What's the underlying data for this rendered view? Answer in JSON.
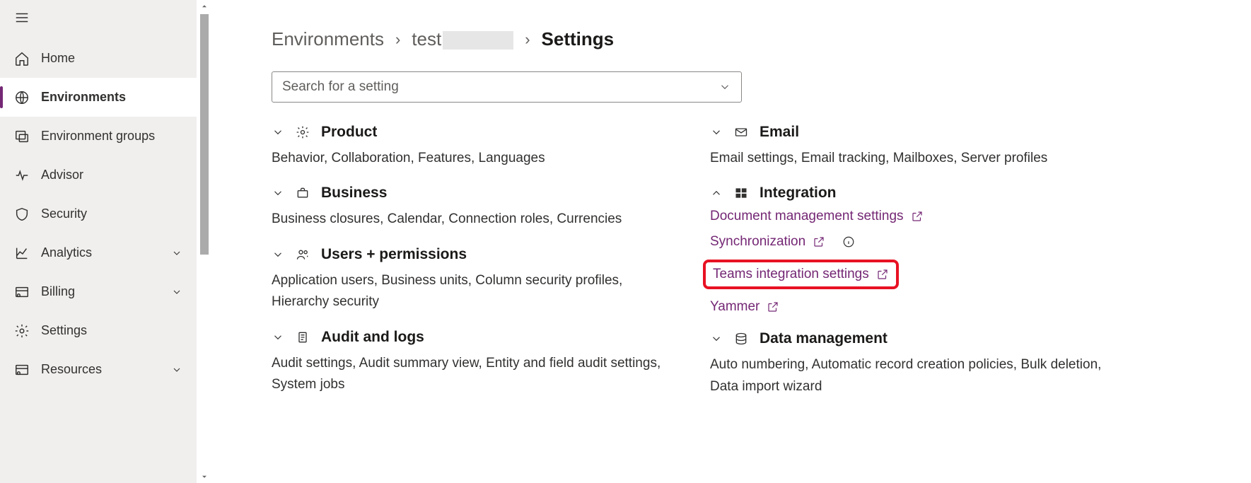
{
  "sidebar": {
    "items": [
      {
        "label": "Home"
      },
      {
        "label": "Environments"
      },
      {
        "label": "Environment groups"
      },
      {
        "label": "Advisor"
      },
      {
        "label": "Security"
      },
      {
        "label": "Analytics"
      },
      {
        "label": "Billing"
      },
      {
        "label": "Settings"
      },
      {
        "label": "Resources"
      }
    ]
  },
  "breadcrumb": {
    "root": "Environments",
    "env": "test",
    "current": "Settings"
  },
  "search": {
    "placeholder": "Search for a setting"
  },
  "left_sections": [
    {
      "title": "Product",
      "sub": "Behavior, Collaboration, Features, Languages"
    },
    {
      "title": "Business",
      "sub": "Business closures, Calendar, Connection roles, Currencies"
    },
    {
      "title": "Users + permissions",
      "sub": "Application users, Business units, Column security profiles, Hierarchy security"
    },
    {
      "title": "Audit and logs",
      "sub": "Audit settings, Audit summary view, Entity and field audit settings, System jobs"
    }
  ],
  "right_sections": {
    "email": {
      "title": "Email",
      "sub": "Email settings, Email tracking, Mailboxes, Server profiles"
    },
    "integration": {
      "title": "Integration",
      "links": [
        {
          "label": "Document management settings"
        },
        {
          "label": "Synchronization"
        },
        {
          "label": "Teams integration settings"
        },
        {
          "label": "Yammer"
        }
      ]
    },
    "data": {
      "title": "Data management",
      "sub": "Auto numbering, Automatic record creation policies, Bulk deletion, Data import wizard"
    }
  }
}
